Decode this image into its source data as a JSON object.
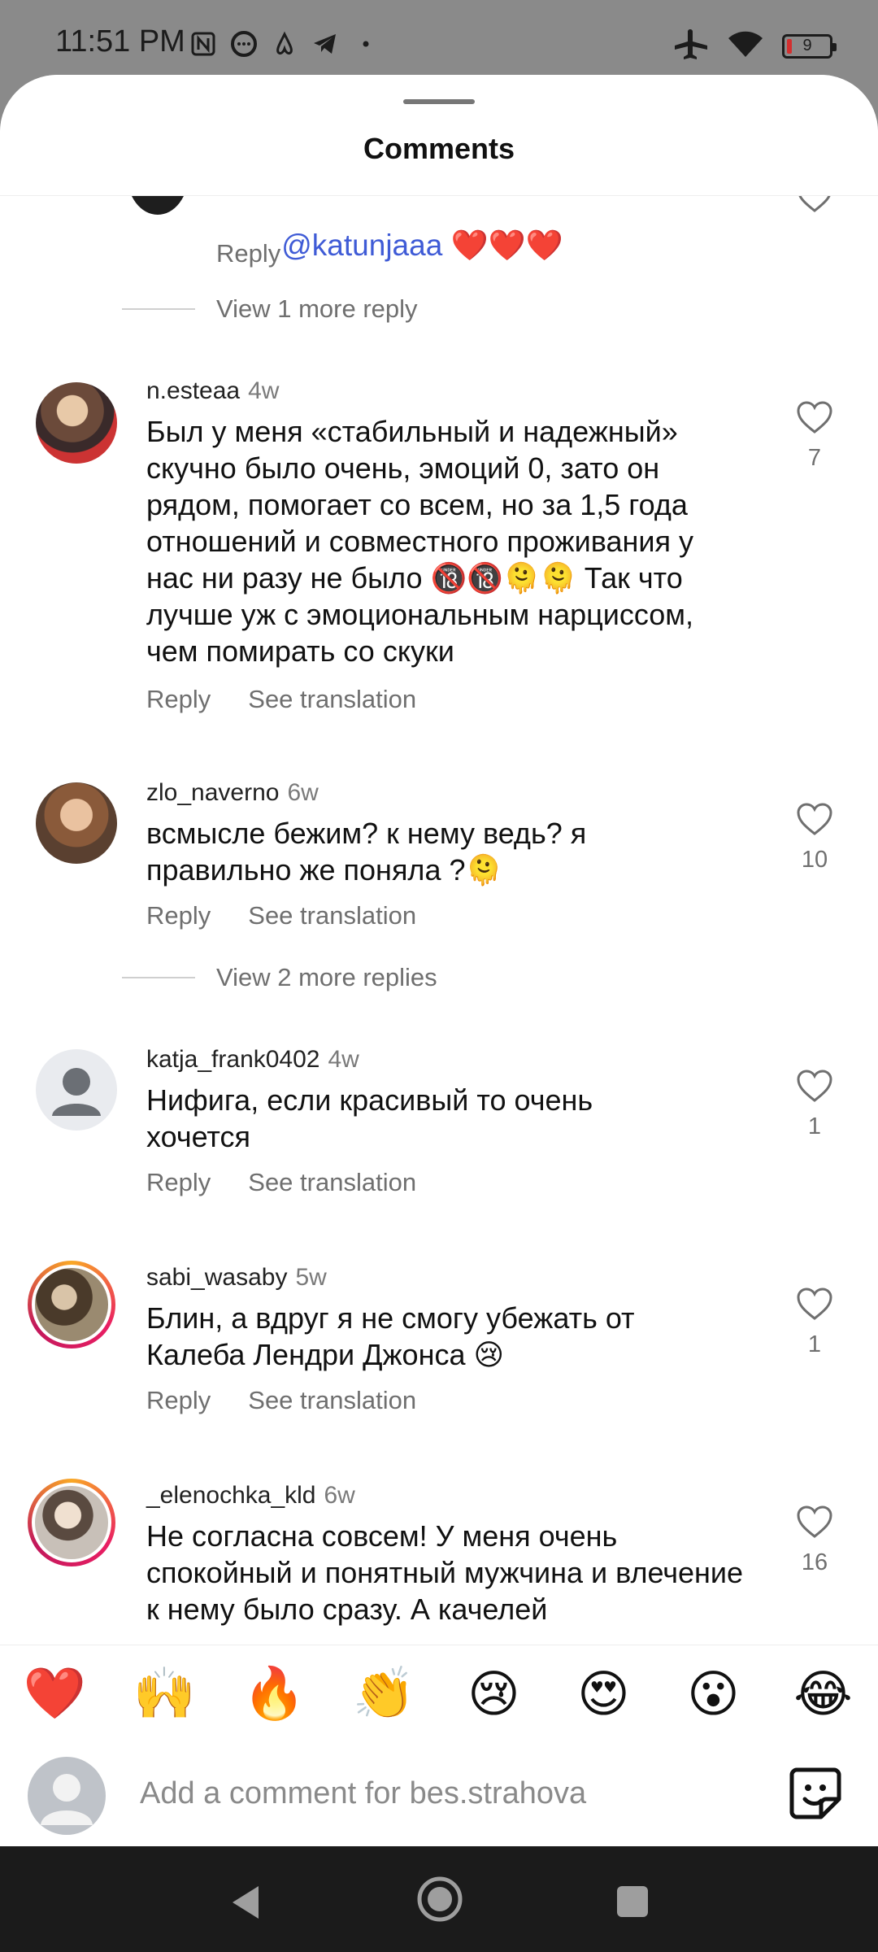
{
  "status": {
    "time": "11:51 PM",
    "battery": "9"
  },
  "sheet": {
    "title": "Comments"
  },
  "partial_comment": {
    "mention": "@katunjaaa",
    "hearts": "❤️❤️❤️",
    "reply_label": "Reply",
    "view_more": "View 1 more reply"
  },
  "comments": [
    {
      "username": "n.esteaa",
      "time": "4w",
      "text": "Был у меня «стабильный и надежный» скучно было очень, эмоций 0, зато он рядом, помогает со всем, но за 1,5 года отношений и совместного проживания у нас ни разу не было 🔞🔞🫠🫠 Так что лучше уж с эмоциональным нарциссом, чем помирать со скуки",
      "likes": "7",
      "reply_label": "Reply",
      "translate_label": "See translation"
    },
    {
      "username": "zlo_naverno",
      "time": "6w",
      "text": "всмысле бежим? к нему ведь? я правильно же поняла ?🫠",
      "likes": "10",
      "reply_label": "Reply",
      "translate_label": "See translation",
      "view_more": "View 2 more replies"
    },
    {
      "username": "katja_frank0402",
      "time": "4w",
      "text": "Нифига, если красивый то очень хочется",
      "likes": "1",
      "reply_label": "Reply",
      "translate_label": "See translation"
    },
    {
      "username": "sabi_wasaby",
      "time": "5w",
      "text": "Блин, а вдруг я не смогу убежать от Калеба Лендри Джонса 😢",
      "likes": "1",
      "reply_label": "Reply",
      "translate_label": "See translation"
    },
    {
      "username": "_elenochka_kld",
      "time": "6w",
      "text": "Не согласна совсем! У меня очень спокойный и понятный мужчина и влечение к нему было сразу. А качелей",
      "likes": "16"
    }
  ],
  "reactions": [
    "❤️",
    "🙌",
    "🔥",
    "👏",
    "😢",
    "😍",
    "😮",
    "😂"
  ],
  "composer": {
    "placeholder": "Add a comment for bes.strahova"
  }
}
